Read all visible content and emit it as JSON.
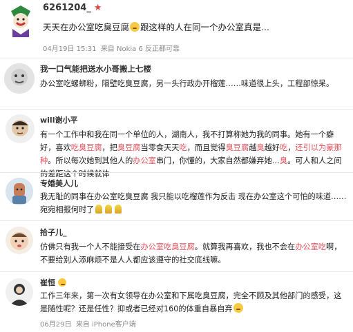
{
  "post": {
    "username": "6261204_",
    "text_before": "天天在办公室吃臭豆腐",
    "text_after": "跟这样的人在同一个办公室真是...",
    "date": "04月19日 15:31",
    "source": "来自 Nokia 6 反正都可靠"
  },
  "comments": [
    {
      "username": "我一口气能把送水小哥搬上七楼",
      "text": "办公室吃螺蛳粉，隔壁吃臭豆腐，另一头行政办开榴莲……味道很上头，工程部惊呆。"
    },
    {
      "username": "will谢小平",
      "text_parts": [
        {
          "t": "有一个工作中和我在同一个单位的人，湖南人，我不打算称她为我的同事。她有一个癖好，喜欢"
        },
        {
          "t": "吃臭豆腐",
          "hl": true
        },
        {
          "t": "，把"
        },
        {
          "t": "臭豆腐",
          "hl": true
        },
        {
          "t": "当零食天天"
        },
        {
          "t": "吃",
          "hl": true
        },
        {
          "t": "，而且觉得"
        },
        {
          "t": "臭豆腐",
          "hl": true
        },
        {
          "t": "越"
        },
        {
          "t": "臭",
          "hl": true
        },
        {
          "t": "越好"
        },
        {
          "t": "吃",
          "hl": true
        },
        {
          "t": "，"
        },
        {
          "t": "还引以为豪那种",
          "hl": true
        },
        {
          "t": "。所以每次她到其他人的"
        },
        {
          "t": "办公室",
          "hl": true
        },
        {
          "t": "串门，你懂的，大家自然都嫌弃她…"
        },
        {
          "t": "臭",
          "hl": true
        },
        {
          "t": "。可人和人之间的差距这个时候就体"
        }
      ]
    },
    {
      "username": "专婚美人儿",
      "text": "我无耻的同事在办公室吃臭豆腐 我只能以吃榴莲作为反击 现在办公室这个可怕的味道……宛宛相报何时了"
    },
    {
      "username": "拾子儿_",
      "text_before": "仿佛只有我一个人不能接受在",
      "text_hl1": "办公室吃臭豆腐",
      "text_mid": "。就算我再喜欢，我也不会在",
      "text_hl2": "办公室吃",
      "text_after": "啊，不要给别人添麻烦不是人人都应该遵守的社交底线嘛。"
    },
    {
      "username": "崔恒",
      "text": "工作三年来，第一次有女领导在办公室和下属吃臭豆腐，完全不顾及其他部门的感受，这是随性呢？还是任性？抑或者已经对160的体重自暴自弃",
      "date": "06月29日",
      "source": "来自 iPhone客户端"
    }
  ],
  "colors": {
    "highlight": "#e8505b",
    "meta": "#8a8a8a",
    "accent_star": "#e0443c"
  }
}
